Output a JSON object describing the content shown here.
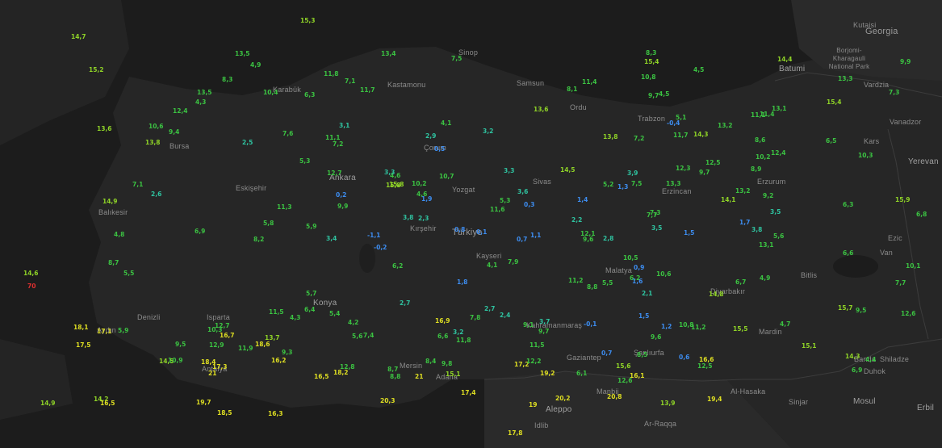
{
  "map": {
    "colors": {
      "land": "#262626",
      "sea": "#1c1c1c",
      "border": "#3c3c3c",
      "cold": "#3d8df0",
      "cool": "#2fc3a0",
      "mild": "#3bc242",
      "warm": "#8fd327",
      "hot": "#dede22",
      "extreme": "#e03030"
    },
    "country_labels": [
      "Georgia",
      "Türkiye"
    ],
    "city_labels": [
      "Kutaisi",
      "Batumi",
      "Vardzia",
      "Vanadzor",
      "Yerevan",
      "Aleppo",
      "Manbij",
      "Al-Hasaka",
      "Ar-Raqqa",
      "Sinjar",
      "Mosul",
      "Erbil",
      "Duhok",
      "Banda",
      "Shiladze",
      "Idlib",
      "Kastamonu",
      "Ankara",
      "Kayseri",
      "Konya",
      "Sivas",
      "Erzurum",
      "Erzincan",
      "Kırşehir",
      "Malatya",
      "Diyarbakır",
      "Şanlıurfa",
      "Kahramanmaraş",
      "Gaziantep",
      "Adana",
      "Mersin",
      "Antalya",
      "Isparta",
      "Denizli",
      "Aydın",
      "Balıkesir",
      "Bursa",
      "Eskişehir",
      "Karabük",
      "Bitlis",
      "Van",
      "Kars",
      "Mardin",
      "Çorum",
      "Yozgat",
      "Trabzon",
      "Samsun",
      "Ordu",
      "Sinop",
      "Ezic"
    ],
    "park_label": "Borjomi-Kharagauli National Park",
    "readings": [
      {
        "v": "13,8",
        "c": "warm"
      },
      {
        "v": "12,6",
        "c": "mild"
      },
      {
        "v": "10,6",
        "c": "mild"
      },
      {
        "v": "14,5",
        "c": "warm"
      },
      {
        "v": "10,8",
        "c": "mild"
      },
      {
        "v": "12,5",
        "c": "mild"
      },
      {
        "v": "11,1",
        "c": "mild"
      },
      {
        "v": "13,6",
        "c": "warm"
      },
      {
        "v": "11,5",
        "c": "mild"
      },
      {
        "v": "15,1",
        "c": "warm"
      },
      {
        "v": "14,9",
        "c": "warm"
      },
      {
        "v": "9,7",
        "c": "mild"
      },
      {
        "v": "12,7",
        "c": "mild"
      },
      {
        "v": "14,3",
        "c": "warm"
      },
      {
        "v": "15,8",
        "c": "warm"
      },
      {
        "v": "13,1",
        "c": "mild"
      },
      {
        "v": "13,8",
        "c": "warm"
      },
      {
        "v": "16,5",
        "c": "hot"
      },
      {
        "v": "15,9",
        "c": "warm"
      },
      {
        "v": "13,2",
        "c": "mild"
      },
      {
        "v": "11,8",
        "c": "mild"
      },
      {
        "v": "12,4",
        "c": "mild"
      },
      {
        "v": "9,7",
        "c": "mild"
      },
      {
        "v": "15,4",
        "c": "warm"
      },
      {
        "v": "11,4",
        "c": "mild"
      },
      {
        "v": "13,3",
        "c": "mild"
      },
      {
        "v": "11,7",
        "c": "mild"
      },
      {
        "v": "10,2",
        "c": "mild"
      },
      {
        "v": "9,8",
        "c": "mild"
      },
      {
        "v": "7,5",
        "c": "mild"
      },
      {
        "v": "6,3",
        "c": "mild"
      },
      {
        "v": "8,3",
        "c": "mild"
      },
      {
        "v": "7,2",
        "c": "mild"
      },
      {
        "v": "4,1",
        "c": "mild"
      },
      {
        "v": "3,5",
        "c": "cool"
      },
      {
        "v": "2,7",
        "c": "cool"
      },
      {
        "v": "5,5",
        "c": "mild"
      },
      {
        "v": "4,8",
        "c": "mild"
      },
      {
        "v": "0,7",
        "c": "cold"
      },
      {
        "v": "1,3",
        "c": "cold"
      },
      {
        "v": "3,2",
        "c": "cool"
      },
      {
        "v": "5,8",
        "c": "mild"
      },
      {
        "v": "6,6",
        "c": "mild"
      },
      {
        "v": "8,7",
        "c": "mild"
      },
      {
        "v": "7,5",
        "c": "mild"
      },
      {
        "v": "4,9",
        "c": "mild"
      },
      {
        "v": "5,4",
        "c": "mild"
      },
      {
        "v": "6,8",
        "c": "mild"
      },
      {
        "v": "8,2",
        "c": "mild"
      },
      {
        "v": "9,6",
        "c": "mild"
      },
      {
        "v": "11,2",
        "c": "mild"
      },
      {
        "v": "10,9",
        "c": "mild"
      },
      {
        "v": "9,4",
        "c": "mild"
      },
      {
        "v": "7,8",
        "c": "mild"
      },
      {
        "v": "5,6",
        "c": "mild"
      },
      {
        "v": "4,3",
        "c": "mild"
      },
      {
        "v": "3,8",
        "c": "cool"
      },
      {
        "v": "2,6",
        "c": "cool"
      },
      {
        "v": "1,5",
        "c": "cold"
      },
      {
        "v": "0,6",
        "c": "cold"
      },
      {
        "v": "-0,1",
        "c": "cold"
      },
      {
        "v": "3,1",
        "c": "cool"
      },
      {
        "v": "5,9",
        "c": "mild"
      },
      {
        "v": "6,2",
        "c": "mild"
      },
      {
        "v": "7,3",
        "c": "mild"
      },
      {
        "v": "8,5",
        "c": "mild"
      },
      {
        "v": "4,5",
        "c": "mild"
      },
      {
        "v": "3,3",
        "c": "cool"
      },
      {
        "v": "2,2",
        "c": "cool"
      },
      {
        "v": "1,8",
        "c": "cold"
      },
      {
        "v": "4,6",
        "c": "mild"
      },
      {
        "v": "5,3",
        "c": "mild"
      },
      {
        "v": "6,9",
        "c": "mild"
      },
      {
        "v": "7,7",
        "c": "mild"
      },
      {
        "v": "9,1",
        "c": "mild"
      },
      {
        "v": "10,2",
        "c": "mild"
      },
      {
        "v": "11,6",
        "c": "mild"
      },
      {
        "v": "12,9",
        "c": "mild"
      },
      {
        "v": "13,4",
        "c": "mild"
      },
      {
        "v": "14,5",
        "c": "warm"
      },
      {
        "v": "15,2",
        "c": "warm"
      },
      {
        "v": "13,5",
        "c": "mild"
      },
      {
        "v": "14,8",
        "c": "warm"
      },
      {
        "v": "12,3",
        "c": "mild"
      },
      {
        "v": "11,3",
        "c": "mild"
      },
      {
        "v": "10,3",
        "c": "mild"
      },
      {
        "v": "9,5",
        "c": "mild"
      },
      {
        "v": "8,8",
        "c": "mild"
      },
      {
        "v": "7,6",
        "c": "mild"
      },
      {
        "v": "6,1",
        "c": "mild"
      },
      {
        "v": "5,7",
        "c": "mild"
      },
      {
        "v": "4,2",
        "c": "mild"
      },
      {
        "v": "3,4",
        "c": "cool"
      },
      {
        "v": "2,8",
        "c": "cool"
      },
      {
        "v": "1,6",
        "c": "cold"
      },
      {
        "v": "0,5",
        "c": "cold"
      },
      {
        "v": "-0,4",
        "c": "cold"
      },
      {
        "v": "-1,1",
        "c": "cold"
      },
      {
        "v": "0,3",
        "c": "cold"
      },
      {
        "v": "0,9",
        "c": "cold"
      },
      {
        "v": "1,4",
        "c": "cold"
      },
      {
        "v": "2,3",
        "c": "cool"
      },
      {
        "v": "3,6",
        "c": "cool"
      },
      {
        "v": "4,4",
        "c": "mild"
      },
      {
        "v": "5,2",
        "c": "mild"
      },
      {
        "v": "6,5",
        "c": "mild"
      },
      {
        "v": "7,1",
        "c": "mild"
      },
      {
        "v": "8,4",
        "c": "mild"
      },
      {
        "v": "9,9",
        "c": "mild"
      },
      {
        "v": "10,7",
        "c": "mild"
      },
      {
        "v": "11,9",
        "c": "mild"
      },
      {
        "v": "12,8",
        "c": "mild"
      },
      {
        "v": "13,9",
        "c": "warm"
      },
      {
        "v": "14,1",
        "c": "warm"
      },
      {
        "v": "15,6",
        "c": "warm"
      },
      {
        "v": "16,3",
        "c": "hot"
      },
      {
        "v": "17,4",
        "c": "hot"
      },
      {
        "v": "16,9",
        "c": "hot"
      },
      {
        "v": "15,7",
        "c": "warm"
      },
      {
        "v": "14,6",
        "c": "warm"
      },
      {
        "v": "13,7",
        "c": "warm"
      },
      {
        "v": "12,5",
        "c": "mild"
      },
      {
        "v": "11,5",
        "c": "mild"
      },
      {
        "v": "10,4",
        "c": "mild"
      },
      {
        "v": "9,3",
        "c": "mild"
      },
      {
        "v": "8,6",
        "c": "mild"
      },
      {
        "v": "7,4",
        "c": "mild"
      },
      {
        "v": "6,7",
        "c": "mild"
      },
      {
        "v": "5,1",
        "c": "mild"
      },
      {
        "v": "4,7",
        "c": "mild"
      },
      {
        "v": "3,9",
        "c": "cool"
      },
      {
        "v": "2,5",
        "c": "cool"
      },
      {
        "v": "1,9",
        "c": "cold"
      },
      {
        "v": "1,1",
        "c": "cold"
      },
      {
        "v": "0,2",
        "c": "cold"
      },
      {
        "v": "3,7",
        "c": "cool"
      },
      {
        "v": "4,9",
        "c": "mild"
      },
      {
        "v": "6,4",
        "c": "mild"
      },
      {
        "v": "7,9",
        "c": "mild"
      },
      {
        "v": "8,1",
        "c": "mild"
      },
      {
        "v": "9,2",
        "c": "mild"
      },
      {
        "v": "10,5",
        "c": "mild"
      },
      {
        "v": "11,7",
        "c": "mild"
      },
      {
        "v": "12,1",
        "c": "mild"
      },
      {
        "v": "13,2",
        "c": "mild"
      },
      {
        "v": "14,9",
        "c": "warm"
      },
      {
        "v": "15,5",
        "c": "warm"
      },
      {
        "v": "16,7",
        "c": "hot"
      },
      {
        "v": "17,8",
        "c": "hot"
      },
      {
        "v": "18,2",
        "c": "hot"
      },
      {
        "v": "19,4",
        "c": "hot"
      },
      {
        "v": "20,3",
        "c": "hot"
      },
      {
        "v": "21",
        "c": "hot"
      },
      {
        "v": "19",
        "c": "hot"
      },
      {
        "v": "18,6",
        "c": "hot"
      },
      {
        "v": "17,1",
        "c": "hot"
      },
      {
        "v": "16,1",
        "c": "hot"
      },
      {
        "v": "15,3",
        "c": "warm"
      },
      {
        "v": "14,2",
        "c": "warm"
      },
      {
        "v": "13,1",
        "c": "mild"
      },
      {
        "v": "12,6",
        "c": "mild"
      },
      {
        "v": "11,2",
        "c": "mild"
      },
      {
        "v": "10,1",
        "c": "mild"
      },
      {
        "v": "9,7",
        "c": "mild"
      },
      {
        "v": "8,9",
        "c": "mild"
      },
      {
        "v": "7,7",
        "c": "mild"
      },
      {
        "v": "6,3",
        "c": "mild"
      },
      {
        "v": "5,5",
        "c": "mild"
      },
      {
        "v": "4,3",
        "c": "mild"
      },
      {
        "v": "3,5",
        "c": "cool"
      },
      {
        "v": "2,9",
        "c": "cool"
      },
      {
        "v": "1,7",
        "c": "cold"
      },
      {
        "v": "0,7",
        "c": "cold"
      },
      {
        "v": "2,1",
        "c": "cool"
      },
      {
        "v": "3,3",
        "c": "cool"
      },
      {
        "v": "4,5",
        "c": "mild"
      },
      {
        "v": "5,9",
        "c": "mild"
      },
      {
        "v": "6,6",
        "c": "mild"
      },
      {
        "v": "7,2",
        "c": "mild"
      },
      {
        "v": "8,3",
        "c": "mild"
      },
      {
        "v": "9,6",
        "c": "mild"
      },
      {
        "v": "10,8",
        "c": "mild"
      },
      {
        "v": "11,1",
        "c": "mild"
      },
      {
        "v": "12,4",
        "c": "mild"
      },
      {
        "v": "13,6",
        "c": "warm"
      },
      {
        "v": "14,4",
        "c": "warm"
      },
      {
        "v": "15,1",
        "c": "warm"
      },
      {
        "v": "16,5",
        "c": "hot"
      },
      {
        "v": "17,2",
        "c": "hot"
      },
      {
        "v": "18,1",
        "c": "hot"
      },
      {
        "v": "19,7",
        "c": "hot"
      },
      {
        "v": "20,8",
        "c": "hot"
      },
      {
        "v": "21",
        "c": "hot"
      },
      {
        "v": "18,5",
        "c": "hot"
      },
      {
        "v": "17,5",
        "c": "hot"
      },
      {
        "v": "16,2",
        "c": "hot"
      },
      {
        "v": "15,8",
        "c": "warm"
      },
      {
        "v": "14,7",
        "c": "warm"
      },
      {
        "v": "13,3",
        "c": "mild"
      },
      {
        "v": "12,2",
        "c": "mild"
      },
      {
        "v": "11,4",
        "c": "mild"
      },
      {
        "v": "10,6",
        "c": "mild"
      },
      {
        "v": "9,5",
        "c": "mild"
      },
      {
        "v": "8,7",
        "c": "mild"
      },
      {
        "v": "7,1",
        "c": "mild"
      },
      {
        "v": "6,2",
        "c": "mild"
      },
      {
        "v": "5,3",
        "c": "mild"
      },
      {
        "v": "4,1",
        "c": "mild"
      },
      {
        "v": "3,2",
        "c": "cool"
      },
      {
        "v": "2,4",
        "c": "cool"
      },
      {
        "v": "1,2",
        "c": "cold"
      },
      {
        "v": "0,1",
        "c": "cold"
      },
      {
        "v": "-0,2",
        "c": "cold"
      },
      {
        "v": "0,8",
        "c": "cold"
      },
      {
        "v": "1,5",
        "c": "cold"
      },
      {
        "v": "2,7",
        "c": "cool"
      },
      {
        "v": "3,8",
        "c": "cool"
      },
      {
        "v": "4,6",
        "c": "mild"
      },
      {
        "v": "5,6",
        "c": "mild"
      },
      {
        "v": "6,9",
        "c": "mild"
      },
      {
        "v": "7,3",
        "c": "mild"
      },
      {
        "v": "8,8",
        "c": "mild"
      },
      {
        "v": "9,9",
        "c": "mild"
      },
      {
        "v": "10,3",
        "c": "mild"
      },
      {
        "v": "11,8",
        "c": "mild"
      },
      {
        "v": "12,7",
        "c": "mild"
      },
      {
        "v": "13,5",
        "c": "mild"
      },
      {
        "v": "14,3",
        "c": "warm"
      },
      {
        "v": "15,4",
        "c": "warm"
      },
      {
        "v": "16,6",
        "c": "hot"
      },
      {
        "v": "17,3",
        "c": "hot"
      },
      {
        "v": "18,4",
        "c": "hot"
      },
      {
        "v": "19,2",
        "c": "hot"
      },
      {
        "v": "20,2",
        "c": "hot"
      },
      {
        "v": "70",
        "c": "extreme"
      }
    ]
  }
}
